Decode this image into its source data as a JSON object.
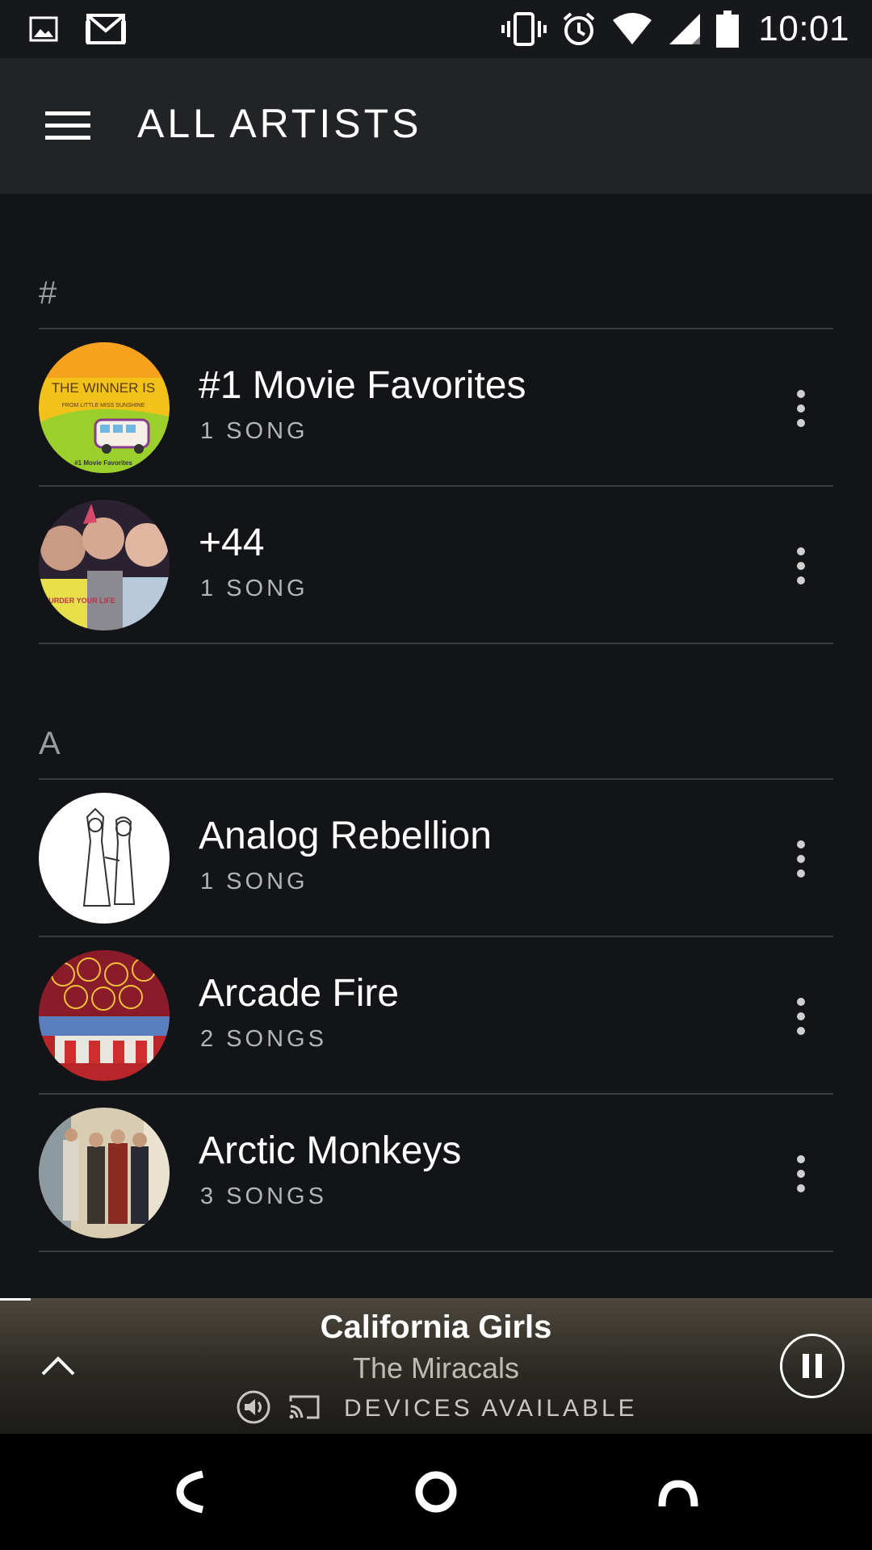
{
  "status_bar": {
    "time": "10:01",
    "icons_left": [
      "image-icon",
      "gmail-icon"
    ],
    "icons_right": [
      "vibrate-icon",
      "alarm-icon",
      "wifi-icon",
      "cell-signal-icon",
      "battery-icon"
    ]
  },
  "header": {
    "title": "ALL ARTISTS",
    "menu_icon": "hamburger-menu-icon"
  },
  "sections": [
    {
      "letter": "#",
      "artists": [
        {
          "name": "#1 Movie Favorites",
          "count": "1 SONG"
        },
        {
          "name": "+44",
          "count": "1 SONG"
        }
      ]
    },
    {
      "letter": "A",
      "artists": [
        {
          "name": "Analog Rebellion",
          "count": "1 SONG"
        },
        {
          "name": "Arcade Fire",
          "count": "2 SONGS"
        },
        {
          "name": "Arctic Monkeys",
          "count": "3 SONGS"
        }
      ]
    }
  ],
  "album_art_text": {
    "winner_headline": "THE WINNER IS",
    "winner_sub": "FROM LITTLE MISS SUNSHINE",
    "winner_footer": "#1 Movie Favorites",
    "plus44_shirt": "HOW TO MURDER YOUR LIFE"
  },
  "now_playing": {
    "title": "California Girls",
    "artist": "The Miracals",
    "devices_label": "DEVICES AVAILABLE",
    "progress_fraction": 0.035
  },
  "nav": {
    "back_icon": "back-icon",
    "home_icon": "home-icon",
    "recents_icon": "recents-icon"
  },
  "colors": {
    "background": "#131417",
    "header": "#222326",
    "divider": "#3a3b3e",
    "subtext": "#b3b4b7"
  }
}
